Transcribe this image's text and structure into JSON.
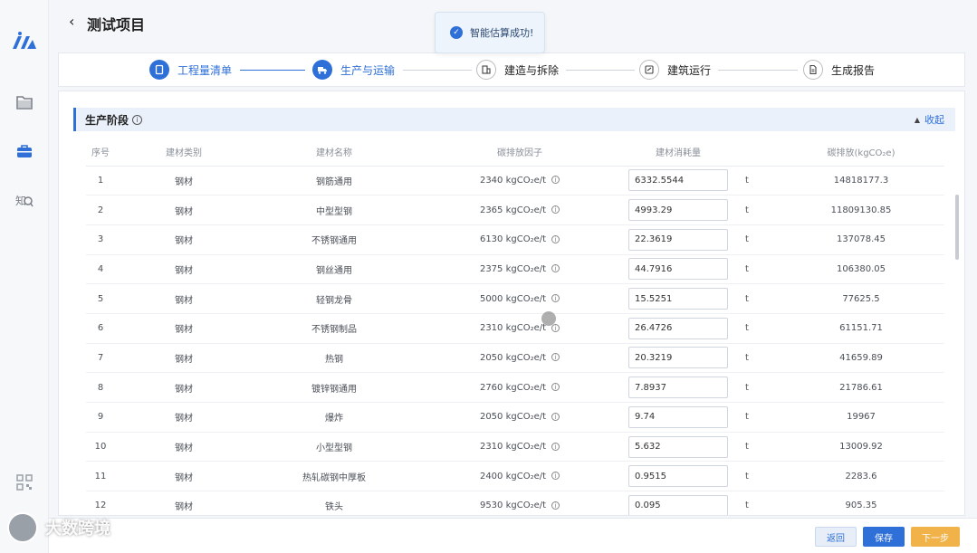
{
  "app": {
    "title": "测试项目",
    "back_icon": "chevron-left-icon"
  },
  "sidebar": {
    "items": [
      {
        "icon": "folder-icon"
      },
      {
        "icon": "briefcase-icon",
        "active": true
      },
      {
        "icon": "knowledge-search-icon"
      },
      {
        "icon": "qr-code-icon"
      }
    ]
  },
  "toast": {
    "text": "智能估算成功!",
    "icon": "check-badge-icon"
  },
  "steps": [
    {
      "label": "工程量清单",
      "icon": "clipboard-icon",
      "state": "active"
    },
    {
      "label": "生产与运输",
      "icon": "truck-icon",
      "state": "active"
    },
    {
      "label": "建造与拆除",
      "icon": "building-icon",
      "state": "idle"
    },
    {
      "label": "建筑运行",
      "icon": "meter-icon",
      "state": "idle"
    },
    {
      "label": "生成报告",
      "icon": "report-icon",
      "state": "idle"
    }
  ],
  "section": {
    "title": "生产阶段",
    "info": "i",
    "collapse_label": "收起",
    "collapse_icon": "triangle-up-icon"
  },
  "table": {
    "headers": [
      "序号",
      "建材类别",
      "建材名称",
      "碳排放因子",
      "建材消耗量",
      "",
      "碳排放(kgCO₂e)"
    ],
    "rows": [
      {
        "no": "1",
        "category": "钢材",
        "name": "钢筋通用",
        "factor": "2340 kgCO₂e/t",
        "qty": "6332.5544",
        "unit": "t",
        "emission": "14818177.3"
      },
      {
        "no": "2",
        "category": "钢材",
        "name": "中型型钢",
        "factor": "2365 kgCO₂e/t",
        "qty": "4993.29",
        "unit": "t",
        "emission": "11809130.85"
      },
      {
        "no": "3",
        "category": "钢材",
        "name": "不锈钢通用",
        "factor": "6130 kgCO₂e/t",
        "qty": "22.3619",
        "unit": "t",
        "emission": "137078.45"
      },
      {
        "no": "4",
        "category": "钢材",
        "name": "钢丝通用",
        "factor": "2375 kgCO₂e/t",
        "qty": "44.7916",
        "unit": "t",
        "emission": "106380.05"
      },
      {
        "no": "5",
        "category": "钢材",
        "name": "轻钢龙骨",
        "factor": "5000 kgCO₂e/t",
        "qty": "15.5251",
        "unit": "t",
        "emission": "77625.5"
      },
      {
        "no": "6",
        "category": "钢材",
        "name": "不锈钢制品",
        "factor": "2310 kgCO₂e/t",
        "qty": "26.4726",
        "unit": "t",
        "emission": "61151.71"
      },
      {
        "no": "7",
        "category": "钢材",
        "name": "热钢",
        "factor": "2050 kgCO₂e/t",
        "qty": "20.3219",
        "unit": "t",
        "emission": "41659.89"
      },
      {
        "no": "8",
        "category": "钢材",
        "name": "镀锌钢通用",
        "factor": "2760 kgCO₂e/t",
        "qty": "7.8937",
        "unit": "t",
        "emission": "21786.61"
      },
      {
        "no": "9",
        "category": "钢材",
        "name": "爆炸",
        "factor": "2050 kgCO₂e/t",
        "qty": "9.74",
        "unit": "t",
        "emission": "19967"
      },
      {
        "no": "10",
        "category": "钢材",
        "name": "小型型钢",
        "factor": "2310 kgCO₂e/t",
        "qty": "5.632",
        "unit": "t",
        "emission": "13009.92"
      },
      {
        "no": "11",
        "category": "钢材",
        "name": "热轧碳钢中厚板",
        "factor": "2400 kgCO₂e/t",
        "qty": "0.9515",
        "unit": "t",
        "emission": "2283.6"
      },
      {
        "no": "12",
        "category": "钢材",
        "name": "铁头",
        "factor": "9530 kgCO₂e/t",
        "qty": "0.095",
        "unit": "t",
        "emission": "905.35"
      }
    ]
  },
  "footer": {
    "back_label": "返回",
    "save_label": "保存",
    "next_label": "下一步"
  },
  "watermark": {
    "text": "大数跨境"
  },
  "colors": {
    "primary": "#2e6fd8",
    "warning": "#f2b24a",
    "section_bg": "#eaf1fb"
  }
}
